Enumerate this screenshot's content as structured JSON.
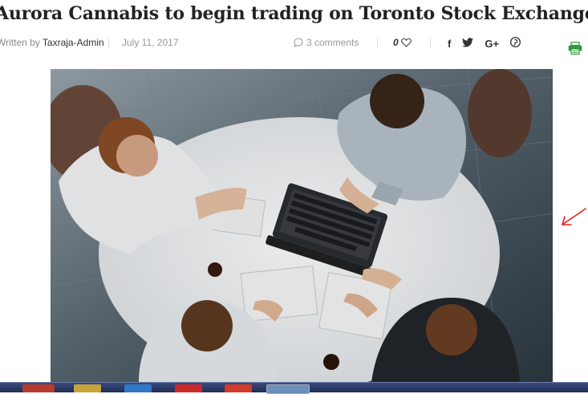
{
  "article": {
    "title": "Aurora Cannabis to begin trading on Toronto Stock Exchange",
    "author_prefix": "Written by",
    "author": "Taxraja-Admin",
    "date": "July 11, 2017",
    "comments": "3 comments",
    "likes": "0"
  },
  "share": {
    "facebook": "f",
    "twitter": "twitter-icon",
    "google_plus": "G+",
    "pinterest": "pinterest-icon"
  },
  "icons": {
    "comment": "comment-icon",
    "heart": "heart-icon",
    "print": "print-icon",
    "annotation": "hand-drawn-arrow"
  },
  "colors": {
    "title": "#222222",
    "meta": "#888888",
    "print": "#2f9a3a",
    "annotation": "#e02020",
    "taskbar": "#24335e"
  }
}
